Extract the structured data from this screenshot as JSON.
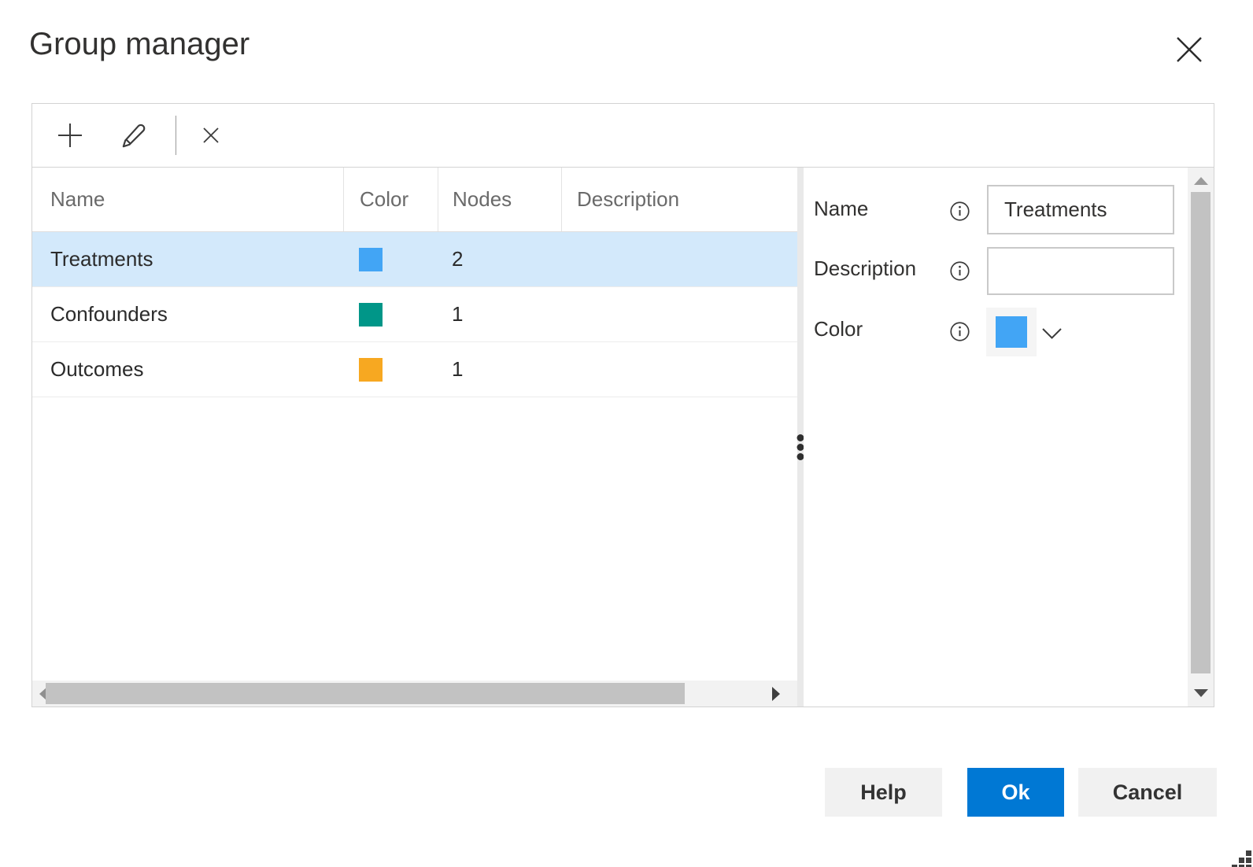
{
  "window": {
    "title": "Group manager"
  },
  "icons": {
    "close": "x-icon",
    "add": "plus-icon",
    "edit": "pencil-icon",
    "remove": "x-icon",
    "info": "info-circle-icon",
    "color_dropdown": "chevron-down-icon",
    "splitter_handle": "vertical-ellipsis-drag-handle",
    "scrollbars": [
      "left-arrow-icon",
      "right-arrow-icon",
      "up-arrow-icon",
      "down-arrow-icon"
    ],
    "resize": "resize-grip-dots"
  },
  "table": {
    "columns": [
      "Name",
      "Color",
      "Nodes",
      "Description"
    ],
    "rows": [
      {
        "name": "Treatments",
        "color": "#42A5F5",
        "nodes": "2",
        "description": "",
        "selected": true
      },
      {
        "name": "Confounders",
        "color": "#009688",
        "nodes": "1",
        "description": "",
        "selected": false
      },
      {
        "name": "Outcomes",
        "color": "#F7A821",
        "nodes": "1",
        "description": "",
        "selected": false
      }
    ]
  },
  "form": {
    "name_label": "Name",
    "name_value": "Treatments",
    "description_label": "Description",
    "description_value": "",
    "color_label": "Color",
    "color_value": "#42A5F5"
  },
  "footer": {
    "help": "Help",
    "ok": "Ok",
    "cancel": "Cancel"
  },
  "colors": {
    "accent": "#0078D4",
    "selected_row_bg": "#D3E9FB",
    "scrollbar_track": "#F2F2F2",
    "scrollbar_thumb": "#C2C2C2"
  }
}
